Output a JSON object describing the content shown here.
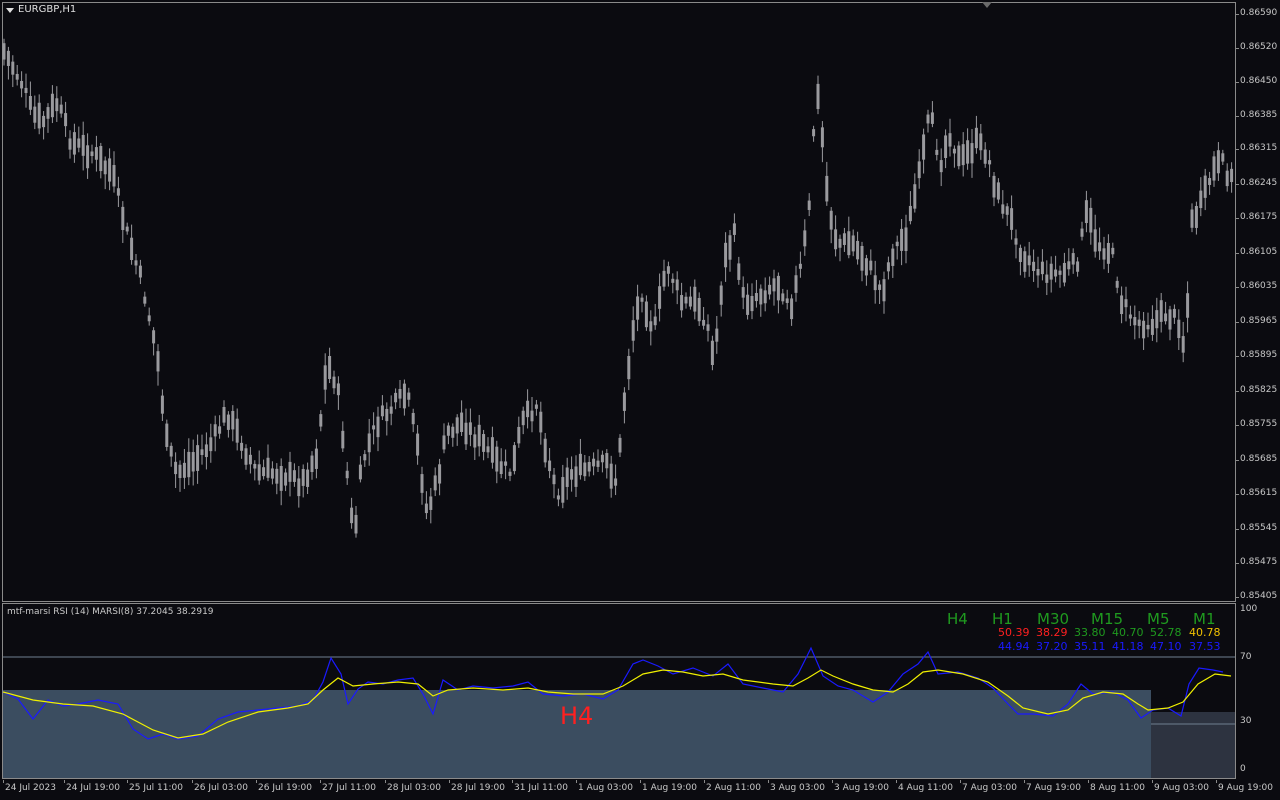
{
  "chart": {
    "symbol_label": "EURGBP,H1",
    "indicator_label": "mtf-marsi  RSI (14)  MARSI(8) 37.2045 38.2919",
    "overlay_label": "H4",
    "colors": {
      "background": "#0b0b10",
      "candle": "#9a9a9e",
      "rsi": "#1a1aff",
      "marsi": "#f0f000",
      "fill": "#3b4d60",
      "fill_right": "#2d3340",
      "up_tf": "#1f9a1f",
      "red": "#ff2020",
      "gold": "#f0c000"
    }
  },
  "price_axis": [
    "0.86590",
    "0.86520",
    "0.86450",
    "0.86385",
    "0.86315",
    "0.86245",
    "0.86175",
    "0.86105",
    "0.86035",
    "0.85965",
    "0.85895",
    "0.85825",
    "0.85755",
    "0.85685",
    "0.85615",
    "0.85545",
    "0.85475",
    "0.85405"
  ],
  "rsi_axis": [
    "100",
    "70",
    "30",
    "0"
  ],
  "time_axis": [
    "24 Jul 2023",
    "24 Jul 19:00",
    "25 Jul 11:00",
    "26 Jul 03:00",
    "26 Jul 19:00",
    "27 Jul 11:00",
    "28 Jul 03:00",
    "28 Jul 19:00",
    "31 Jul 11:00",
    "1 Aug 03:00",
    "1 Aug 19:00",
    "2 Aug 11:00",
    "3 Aug 03:00",
    "3 Aug 19:00",
    "4 Aug 11:00",
    "7 Aug 03:00",
    "7 Aug 19:00",
    "8 Aug 11:00",
    "9 Aug 03:00",
    "9 Aug 19:00"
  ],
  "timeframes": [
    {
      "name": "H4",
      "v1": "",
      "v2": ""
    },
    {
      "name": "H1",
      "v1": "50.39",
      "v2": "44.94",
      "c1": "#ff2020",
      "c2": "#1a1aff"
    },
    {
      "name": "M30",
      "v1": "38.29",
      "v2": "37.20",
      "c1": "#ff2020",
      "c2": "#1a1aff"
    },
    {
      "name": "M15",
      "v1": "33.80",
      "v2": "35.11",
      "c1": "#1f9a1f",
      "c2": "#1a1aff"
    },
    {
      "name": "M5",
      "v1": "40.70",
      "v2": "41.18",
      "c1": "#1f9a1f",
      "c2": "#1a1aff"
    },
    {
      "name": "M1",
      "v1": "52.78",
      "v2": "47.10",
      "c1": "#1f9a1f",
      "c2": "#1a1aff"
    },
    {
      "name": "",
      "v1": "40.78",
      "v2": "37.53",
      "c1": "#f0c000",
      "c2": "#1a1aff"
    }
  ],
  "chart_data": {
    "type": "line",
    "series": [
      {
        "name": "RSI (14)"
      },
      {
        "name": "MARSI(8)"
      }
    ],
    "rsi_last": 37.2045,
    "marsi_last": 38.2919,
    "price_range": [
      0.85405,
      0.8659
    ],
    "rsi_range": [
      0,
      100
    ],
    "rsi_levels": [
      30,
      70
    ]
  }
}
